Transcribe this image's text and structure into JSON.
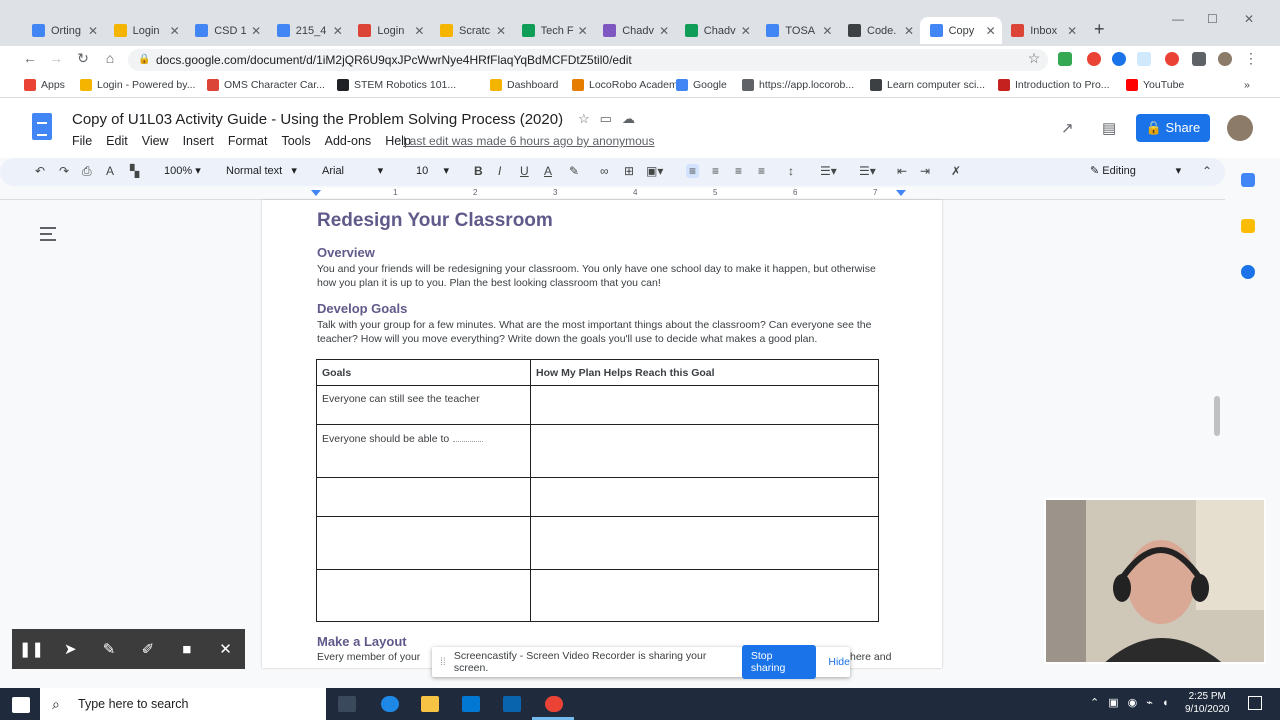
{
  "browser": {
    "tabs": [
      {
        "label": "Orting",
        "color": "#4285f4"
      },
      {
        "label": "Login",
        "color": "#f4b400"
      },
      {
        "label": "CSD 1",
        "color": "#4285f4"
      },
      {
        "label": "215_4",
        "color": "#4285f4"
      },
      {
        "label": "Login",
        "color": "#db4437"
      },
      {
        "label": "Scratc",
        "color": "#f4b400"
      },
      {
        "label": "Tech F",
        "color": "#0f9d58"
      },
      {
        "label": "Chadv",
        "color": "#7e57c2"
      },
      {
        "label": "Chadv",
        "color": "#0f9d58"
      },
      {
        "label": "TOSA",
        "color": "#4285f4"
      },
      {
        "label": "Code.",
        "color": "#3c4043"
      },
      {
        "label": "Copy",
        "color": "#4285f4"
      },
      {
        "label": "Inbox",
        "color": "#db4437"
      }
    ],
    "url": "docs.google.com/document/d/1iM2jQR6U9qxJPcWwrNye4HRfFlaqYqBdMCFDtZ5til0/edit",
    "bookmarks": [
      {
        "label": "Apps",
        "color": "#ea4335"
      },
      {
        "label": "Login - Powered by...",
        "color": "#f4b400"
      },
      {
        "label": "OMS Character Car...",
        "color": "#db4437"
      },
      {
        "label": "STEM Robotics 101...",
        "color": "#202124"
      },
      {
        "label": "Dashboard",
        "color": "#f4b400"
      },
      {
        "label": "LocoRobo Academ...",
        "color": "#e67c00"
      },
      {
        "label": "Google",
        "color": "#4285f4"
      },
      {
        "label": "https://app.locorob...",
        "color": "#5f6368"
      },
      {
        "label": "Learn computer sci...",
        "color": "#3c4043"
      },
      {
        "label": "Introduction to Pro...",
        "color": "#c5221f"
      },
      {
        "label": "YouTube",
        "color": "#ff0000"
      }
    ]
  },
  "docs": {
    "title": "Copy of U1L03 Activity Guide - Using the Problem Solving Process (2020)",
    "menu": [
      "File",
      "Edit",
      "View",
      "Insert",
      "Format",
      "Tools",
      "Add-ons",
      "Help"
    ],
    "last_edit": "Last edit was made 6 hours ago by anonymous",
    "share_label": "Share",
    "toolbar": {
      "zoom": "100%",
      "style": "Normal text",
      "font": "Arial",
      "size": "10",
      "mode": "Editing"
    },
    "ruler_numbers": [
      "1",
      "2",
      "3",
      "4",
      "5",
      "6",
      "7"
    ]
  },
  "document": {
    "heading": "Redesign Your Classroom",
    "overview_heading": "Overview",
    "overview_text": "You and your friends will be redesigning your classroom. You only have one school day to make it happen, but otherwise how you plan it is up to you. Plan the best looking classroom that you can!",
    "goals_heading": "Develop Goals",
    "goals_text": "Talk with your group for a few minutes. What are the most important things about the classroom? Can everyone see the teacher? How will you move everything? Write down the goals you'll use to decide what makes a good plan.",
    "table": {
      "headers": [
        "Goals",
        "How My Plan Helps Reach this Goal"
      ],
      "rows": [
        [
          "Everyone can still see the teacher",
          ""
        ],
        [
          "Everyone should be able to",
          ""
        ],
        [
          "",
          ""
        ],
        [
          "",
          ""
        ],
        [
          "",
          ""
        ]
      ]
    },
    "layout_heading": "Make a Layout",
    "layout_text_start": "Every member of your",
    "layout_text_end": "here and"
  },
  "screencastify": {
    "message": "Screencastify - Screen Video Recorder is sharing your screen.",
    "stop_label": "Stop sharing",
    "hide_label": "Hide"
  },
  "taskbar": {
    "search_placeholder": "Type here to search",
    "time": "2:25 PM",
    "date": "9/10/2020"
  }
}
